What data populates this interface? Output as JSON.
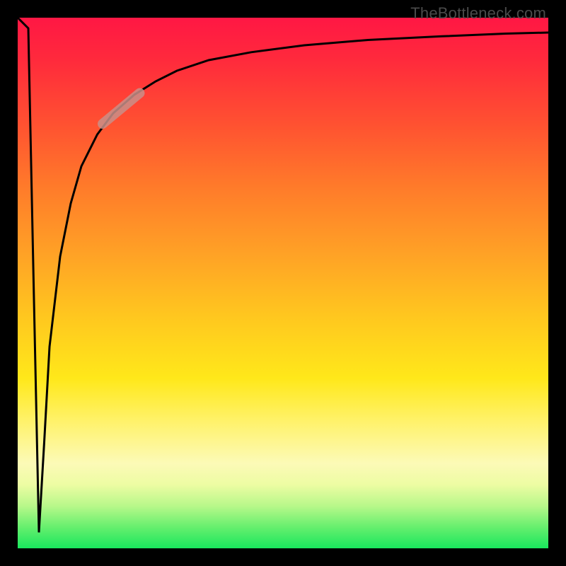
{
  "attribution": "TheBottleneck.com",
  "colors": {
    "background": "#000000",
    "curve_stroke": "#000000",
    "highlight_stroke": "#c98f88"
  },
  "chart_data": {
    "type": "line",
    "title": "",
    "xlabel": "",
    "ylabel": "",
    "xlim": [
      0,
      100
    ],
    "ylim": [
      0,
      100
    ],
    "grid": false,
    "legend": false,
    "series": [
      {
        "name": "curve",
        "x": [
          0,
          2,
          3,
          4,
          5,
          6,
          8,
          10,
          12,
          15,
          18,
          22,
          26,
          30,
          36,
          44,
          54,
          66,
          80,
          92,
          100
        ],
        "y": [
          100,
          98,
          50,
          3,
          20,
          38,
          55,
          65,
          72,
          78,
          82,
          85.5,
          88,
          90,
          92,
          93.5,
          94.8,
          95.8,
          96.5,
          97,
          97.2
        ]
      },
      {
        "name": "highlight-segment",
        "x": [
          16,
          23
        ],
        "y": [
          80,
          85.8
        ]
      }
    ]
  }
}
